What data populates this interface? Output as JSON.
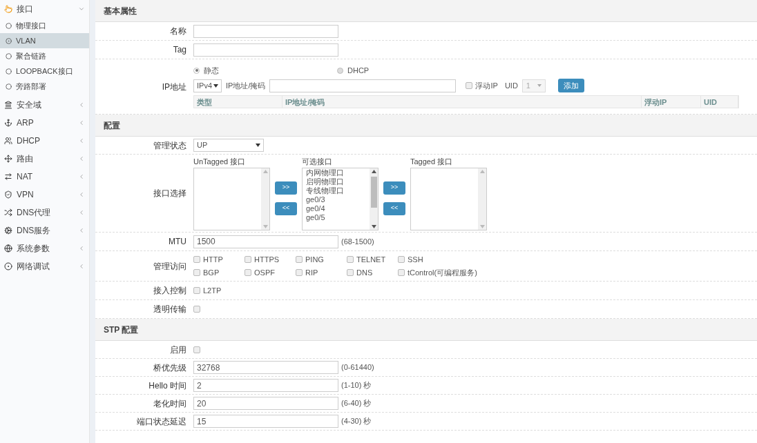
{
  "sidebar": {
    "items": [
      {
        "label": "接口",
        "expanded": true,
        "children": [
          {
            "label": "物理接口",
            "selected": false
          },
          {
            "label": "VLAN",
            "selected": true
          },
          {
            "label": "聚合链路",
            "selected": false
          },
          {
            "label": "LOOPBACK接口",
            "selected": false
          },
          {
            "label": "旁路部署",
            "selected": false
          }
        ]
      },
      {
        "label": "安全域",
        "expanded": false
      },
      {
        "label": "ARP",
        "expanded": false
      },
      {
        "label": "DHCP",
        "expanded": false
      },
      {
        "label": "路由",
        "expanded": false
      },
      {
        "label": "NAT",
        "expanded": false
      },
      {
        "label": "VPN",
        "expanded": false
      },
      {
        "label": "DNS代理",
        "expanded": false
      },
      {
        "label": "DNS服务",
        "expanded": false
      },
      {
        "label": "系统参数",
        "expanded": false
      },
      {
        "label": "网络调试",
        "expanded": false
      }
    ]
  },
  "basic": {
    "title": "基本属性",
    "name_label": "名称",
    "tag_label": "Tag",
    "ip_label": "IP地址",
    "modes": [
      {
        "label": "静态",
        "selected": true
      },
      {
        "label": "DHCP",
        "selected": false
      }
    ],
    "ip_version": "IPv4",
    "ip_mask_label": "IP地址/掩码",
    "floating": {
      "label": "浮动IP",
      "checked": false
    },
    "uid_label": "UID",
    "uid_value": "1",
    "add_button": "添加",
    "table_columns": [
      "类型",
      "IP地址/掩码",
      "浮动IP",
      "UID"
    ]
  },
  "config": {
    "title": "配置",
    "admin_label": "管理状态",
    "admin_value": "UP",
    "select_label": "接口选择",
    "untagged_label": "UnTagged 接口",
    "available_label": "可选接口",
    "tagged_label": "Tagged 接口",
    "available_items": [
      "内网物理口",
      "启明物理口",
      "专线物理口",
      "ge0/3",
      "ge0/4",
      "ge0/5"
    ],
    "move_right": ">>",
    "move_left": "<<",
    "mtu_label": "MTU",
    "mtu_value": "1500",
    "mtu_hint": "(68-1500)",
    "access_label": "管理访问",
    "access": [
      {
        "label": "HTTP",
        "checked": false
      },
      {
        "label": "HTTPS",
        "checked": false
      },
      {
        "label": "PING",
        "checked": false
      },
      {
        "label": "TELNET",
        "checked": false
      },
      {
        "label": "SSH",
        "checked": false
      },
      {
        "label": "BGP",
        "checked": false
      },
      {
        "label": "OSPF",
        "checked": false
      },
      {
        "label": "RIP",
        "checked": false
      },
      {
        "label": "DNS",
        "checked": false
      },
      {
        "label": "tControl(可编程服务)",
        "checked": false
      }
    ],
    "admission_label": "接入控制",
    "admission": [
      {
        "label": "L2TP",
        "checked": false
      }
    ],
    "transparent_label": "透明传输",
    "transparent_checked": false
  },
  "stp": {
    "title": "STP 配置",
    "enable_label": "启用",
    "enable_checked": false,
    "fields": [
      {
        "label": "桥优先级",
        "value": "32768",
        "hint": "(0-61440)"
      },
      {
        "label": "Hello 时间",
        "value": "2",
        "hint": "(1-10) 秒"
      },
      {
        "label": "老化时间",
        "value": "20",
        "hint": "(6-40) 秒"
      },
      {
        "label": "端口状态延迟",
        "value": "15",
        "hint": "(4-30) 秒"
      }
    ]
  }
}
